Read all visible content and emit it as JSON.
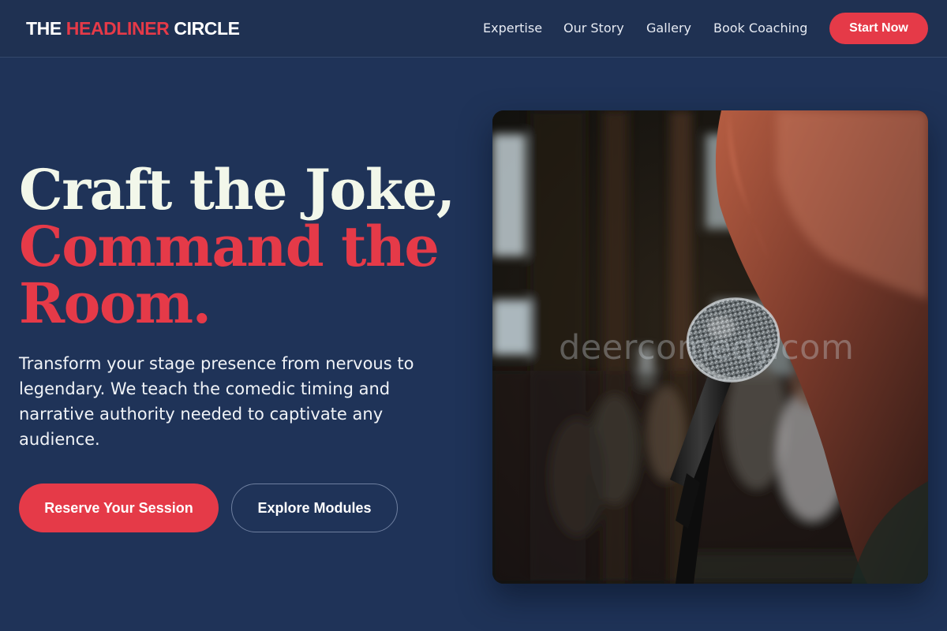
{
  "header": {
    "logo": {
      "part1": "THE ",
      "part2": "HEADLINER",
      "part3": " CIRCLE"
    },
    "nav": [
      {
        "label": "Expertise"
      },
      {
        "label": "Our Story"
      },
      {
        "label": "Gallery"
      },
      {
        "label": "Book Coaching"
      }
    ],
    "cta": "Start Now"
  },
  "hero": {
    "headline": {
      "line1": "Craft the Joke,",
      "line2": "Command the",
      "line3": "Room."
    },
    "subcopy": "Transform your stage presence from nervous to legendary. We teach the comedic timing and narrative authority needed to captivate any audience.",
    "primary_button": "Reserve Your Session",
    "secondary_button": "Explore Modules"
  },
  "image": {
    "watermark": "deercomedy.com"
  },
  "colors": {
    "background": "#1f3358",
    "header": "#1f3152",
    "accent": "#e53a48",
    "headline_light": "#f2f7ea"
  }
}
